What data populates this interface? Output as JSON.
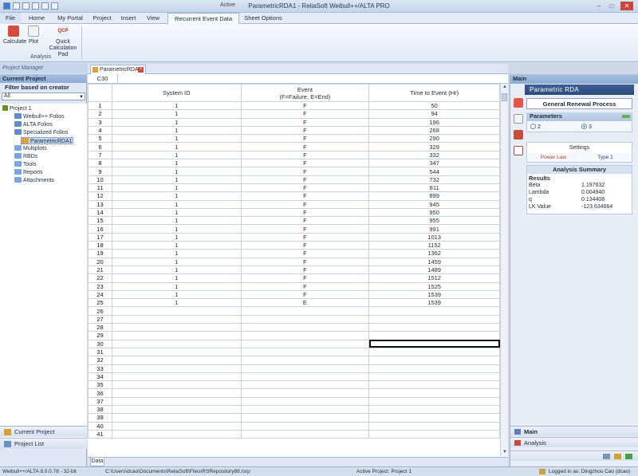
{
  "window": {
    "title": "ParametricRDA1 - ReliaSoft Weibull++/ALTA PRO",
    "active_tag": "Active"
  },
  "ribbon": {
    "tabs": [
      "File",
      "Home",
      "My Portal",
      "Project",
      "Insert",
      "View",
      "Recurrent Event Data",
      "Sheet Options"
    ],
    "buttons": {
      "calculate": "Calculate",
      "plot": "Plot",
      "quick_calc": "Quick Calculation Pad",
      "quick_calc_badge": "QCP"
    },
    "group_label": "Analysis"
  },
  "left_panel": {
    "header": "Project Manager",
    "current_project": "Current Project",
    "filter_label": "Filter based on creator",
    "filter_value": "All",
    "tree": {
      "project": "Project 1",
      "weibull": "Weibull++ Folios",
      "alta": "ALTA Folios",
      "specialized": "Specialized Folios",
      "parametric": "ParametricRDA1",
      "multiplots": "Multiplots",
      "rbds": "RBDs",
      "tools": "Tools",
      "reports": "Reports",
      "attachments": "Attachments"
    },
    "nav_current": "Current Project",
    "nav_list": "Project List"
  },
  "document": {
    "tab_label": "ParametricRDA1",
    "cell_ref": "C30",
    "sheet_tab": "Data",
    "columns": {
      "system_id": "System ID",
      "event_line1": "Event",
      "event_line2": "(F=Failure, E=End)",
      "time": "Time to Event (Hr)"
    },
    "rows": [
      [
        "1",
        "F",
        "50"
      ],
      [
        "1",
        "F",
        "94"
      ],
      [
        "1",
        "F",
        "196"
      ],
      [
        "1",
        "F",
        "268"
      ],
      [
        "1",
        "F",
        "290"
      ],
      [
        "1",
        "F",
        "329"
      ],
      [
        "1",
        "F",
        "332"
      ],
      [
        "1",
        "F",
        "347"
      ],
      [
        "1",
        "F",
        "544"
      ],
      [
        "1",
        "F",
        "732"
      ],
      [
        "1",
        "F",
        "811"
      ],
      [
        "1",
        "F",
        "899"
      ],
      [
        "1",
        "F",
        "945"
      ],
      [
        "1",
        "F",
        "950"
      ],
      [
        "1",
        "F",
        "955"
      ],
      [
        "1",
        "F",
        "991"
      ],
      [
        "1",
        "F",
        "1013"
      ],
      [
        "1",
        "F",
        "1152"
      ],
      [
        "1",
        "F",
        "1362"
      ],
      [
        "1",
        "F",
        "1459"
      ],
      [
        "1",
        "F",
        "1489"
      ],
      [
        "1",
        "F",
        "1512"
      ],
      [
        "1",
        "F",
        "1525"
      ],
      [
        "1",
        "F",
        "1539"
      ],
      [
        "1",
        "E",
        "1539"
      ]
    ],
    "total_rows": 41,
    "selected_row": 30
  },
  "right_panel": {
    "header": "Main",
    "banner": "Parametric RDA",
    "model": "General Renewal Process",
    "parameters_label": "Parameters",
    "param_options": [
      "2",
      "3"
    ],
    "param_selected": "3",
    "settings_label": "Settings",
    "setting_model": "Power Law",
    "setting_type": "Type 1",
    "summary_title": "Analysis Summary",
    "results_label": "Results",
    "results": [
      {
        "name": "Beta",
        "value": "1.197632"
      },
      {
        "name": "Lambda",
        "value": "0.004940"
      },
      {
        "name": "q",
        "value": "0.134408"
      },
      {
        "name": "LK Value",
        "value": "-123.634664"
      }
    ],
    "nav_main": "Main",
    "nav_analysis": "Analysis"
  },
  "status_bar": {
    "version": "Weibull++/ALTA 8.0.0.78 - 32-bit",
    "path": "C:\\Users\\dcao\\Documents\\ReliaSoft\\Files\\RSRepository88.rsrp",
    "active_project": "Active Project: Project 1",
    "login": "Logged in as: Dingzhou Cao (dcao)"
  },
  "colors": {
    "accent": "#2d4a7c",
    "power_law": "#c0392b",
    "type1": "#2146a0"
  }
}
